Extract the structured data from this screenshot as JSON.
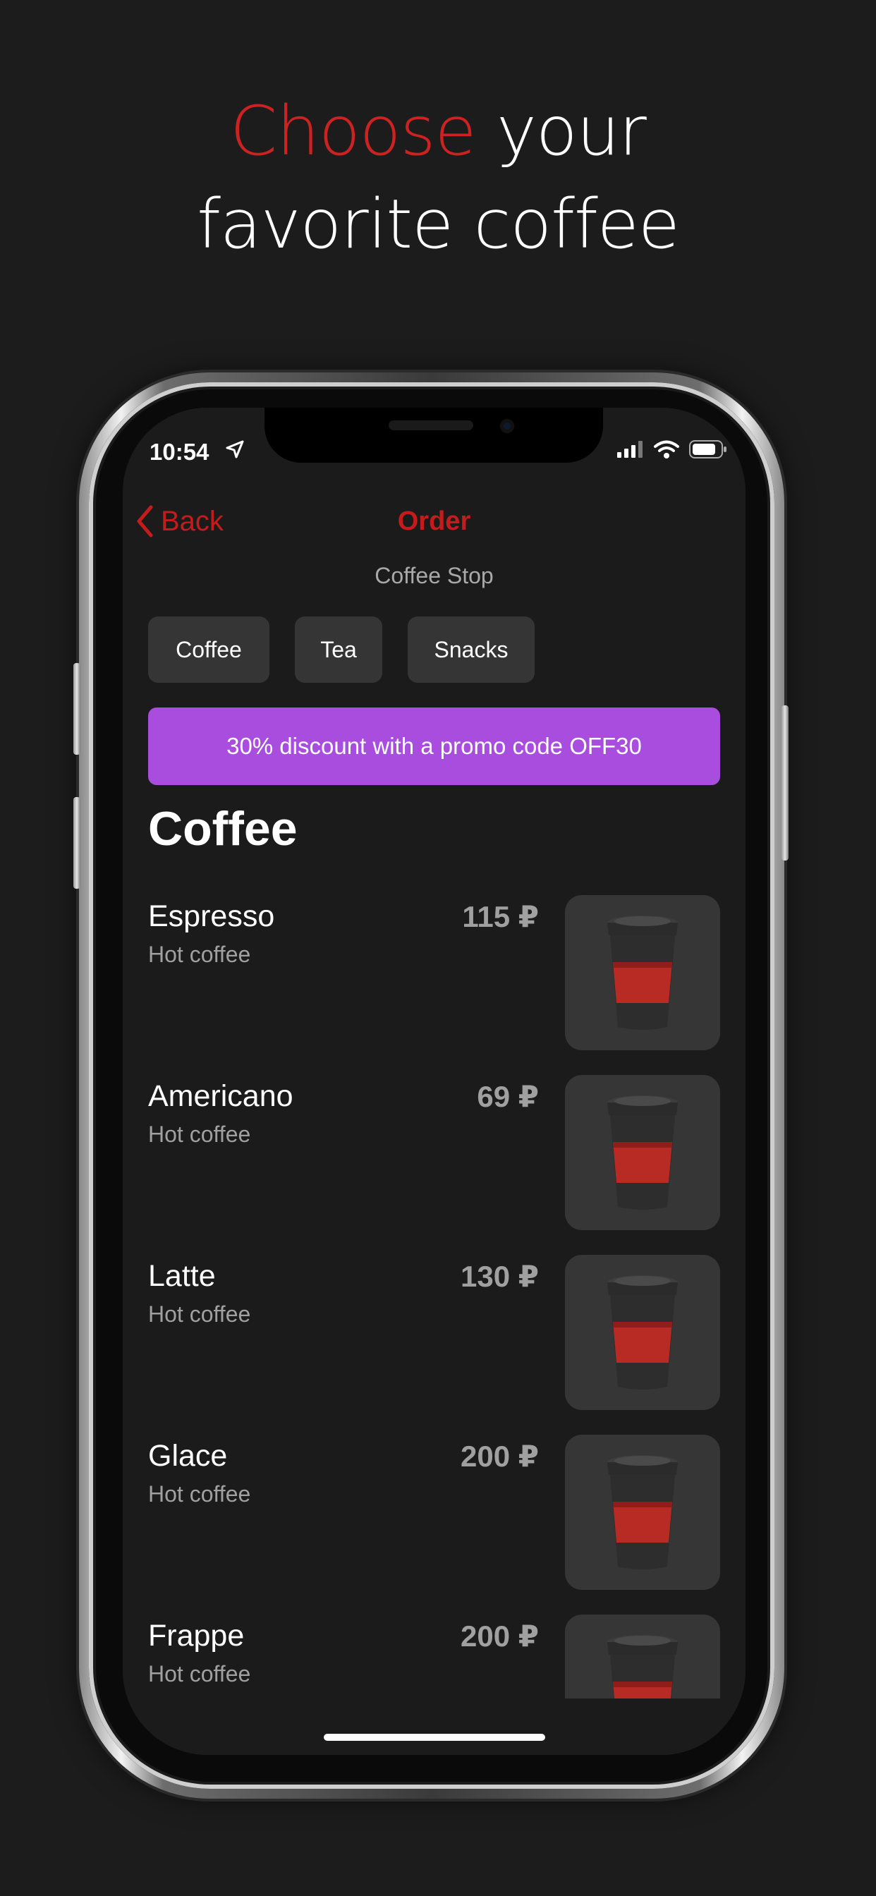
{
  "headline": {
    "accent": "Choose",
    "rest1": " your",
    "line2": "favorite coffee"
  },
  "status": {
    "time": "10:54"
  },
  "nav": {
    "back": "Back",
    "title": "Order",
    "subtitle": "Coffee Stop"
  },
  "chips": [
    "Coffee",
    "Tea",
    "Snacks"
  ],
  "promo": "30% discount with a promo code OFF30",
  "section": "Coffee",
  "items": [
    {
      "name": "Espresso",
      "desc": "Hot coffee",
      "price": "115 ₽"
    },
    {
      "name": "Americano",
      "desc": "Hot coffee",
      "price": "69 ₽"
    },
    {
      "name": "Latte",
      "desc": "Hot coffee",
      "price": "130 ₽"
    },
    {
      "name": "Glace",
      "desc": "Hot coffee",
      "price": "200 ₽"
    },
    {
      "name": "Frappe",
      "desc": "Hot coffee",
      "price": "200 ₽"
    }
  ],
  "colors": {
    "accent": "#c41c1c",
    "promo": "#a94ddf",
    "background": "#1b1b1b"
  },
  "icons": [
    "location-arrow-icon",
    "cellular-signal-icon",
    "wifi-icon",
    "battery-icon",
    "chevron-left-icon",
    "coffee-cup-icon"
  ]
}
